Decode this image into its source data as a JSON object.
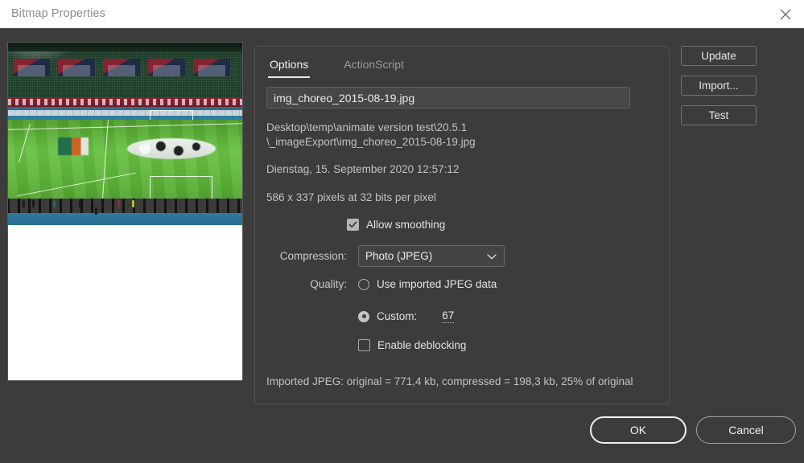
{
  "window": {
    "title": "Bitmap Properties",
    "close_icon": "close-icon"
  },
  "preview": {
    "alt": "stadium-choreography-photo"
  },
  "tabs": [
    {
      "label": "Options",
      "active": true
    },
    {
      "label": "ActionScript",
      "active": false
    }
  ],
  "options": {
    "filename": "img_choreo_2015-08-19.jpg",
    "filename_placeholder": "File name",
    "path": "Desktop\\temp\\animate version test\\20.5.1\n\\_imageExport\\img_choreo_2015-08-19.jpg",
    "date": "Dienstag, 15. September 2020  12:57:12",
    "dimensions": "586 x 337 pixels at 32 bits per pixel",
    "allow_smoothing": {
      "label": "Allow smoothing",
      "checked": true
    },
    "compression": {
      "label": "Compression:",
      "value": "Photo (JPEG)",
      "chevron_icon": "chevron-down-icon"
    },
    "quality": {
      "label": "Quality:",
      "use_imported_label": "Use imported JPEG data",
      "use_imported_selected": false,
      "custom_label": "Custom:",
      "custom_selected": true,
      "custom_value": "67"
    },
    "deblocking": {
      "label": "Enable deblocking",
      "checked": false
    },
    "size_info": "Imported JPEG: original = 771,4 kb, compressed = 198,3 kb, 25% of original"
  },
  "side_buttons": [
    {
      "label": "Update"
    },
    {
      "label": "Import..."
    },
    {
      "label": "Test"
    }
  ],
  "footer": {
    "ok_label": "OK",
    "cancel_label": "Cancel"
  },
  "colors": {
    "dialog_bg": "#3c3c3c",
    "titlebar_bg": "#ffffff",
    "title_text": "#8d8d8d",
    "body_text": "#c2c2c2",
    "accent_border": "#f0f0f0"
  }
}
